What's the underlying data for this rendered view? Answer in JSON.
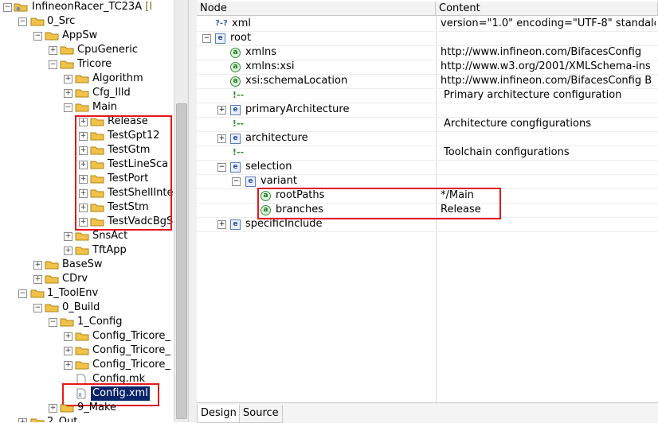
{
  "tree": {
    "items": [
      {
        "label": "InfineonRacer_TC23A",
        "suffix": "[I"
      },
      {
        "label": "0_Src"
      },
      {
        "label": "AppSw"
      },
      {
        "label": "CpuGeneric"
      },
      {
        "label": "Tricore"
      },
      {
        "label": "Algorithm"
      },
      {
        "label": "Cfg_Illd"
      },
      {
        "label": "Main"
      },
      {
        "label": "Release"
      },
      {
        "label": "TestGpt12"
      },
      {
        "label": "TestGtm"
      },
      {
        "label": "TestLineSca"
      },
      {
        "label": "TestPort"
      },
      {
        "label": "TestShellInte"
      },
      {
        "label": "TestStm"
      },
      {
        "label": "TestVadcBgS"
      },
      {
        "label": "SnsAct"
      },
      {
        "label": "TftApp"
      },
      {
        "label": "BaseSw"
      },
      {
        "label": "CDrv"
      },
      {
        "label": "1_ToolEnv"
      },
      {
        "label": "0_Build"
      },
      {
        "label": "1_Config"
      },
      {
        "label": "Config_Tricore_"
      },
      {
        "label": "Config_Tricore_"
      },
      {
        "label": "Config_Tricore_"
      },
      {
        "label": "Config.mk"
      },
      {
        "label": "Config.xml"
      },
      {
        "label": "9_Make"
      },
      {
        "label": "2_Out"
      }
    ]
  },
  "table": {
    "headers": {
      "node": "Node",
      "content": "Content"
    },
    "rows": [
      {
        "icon": "?-?",
        "name": "xml",
        "content": "version=\"1.0\" encoding=\"UTF-8\" standalo"
      },
      {
        "icon": "e",
        "name": "root",
        "content": ""
      },
      {
        "icon": "a",
        "name": "xmlns",
        "content": "http://www.infineon.com/BifacesConfig"
      },
      {
        "icon": "a",
        "name": "xmlns:xsi",
        "content": "http://www.w3.org/2001/XMLSchema-ins"
      },
      {
        "icon": "a",
        "name": "xsi:schemaLocation",
        "content": "http://www.infineon.com/BifacesConfig B"
      },
      {
        "icon": "c",
        "name": "",
        "content": "Primary architecture configuration"
      },
      {
        "icon": "e",
        "name": "primaryArchitecture",
        "content": ""
      },
      {
        "icon": "c",
        "name": "",
        "content": "Architecture congfigurations"
      },
      {
        "icon": "e",
        "name": "architecture",
        "content": ""
      },
      {
        "icon": "c",
        "name": "",
        "content": "Toolchain configurations"
      },
      {
        "icon": "e",
        "name": "selection",
        "content": ""
      },
      {
        "icon": "e",
        "name": "variant",
        "content": ""
      },
      {
        "icon": "a",
        "name": "rootPaths",
        "content": "*/Main"
      },
      {
        "icon": "a",
        "name": "branches",
        "content": "Release"
      },
      {
        "icon": "e",
        "name": "specificInclude",
        "content": ""
      }
    ]
  },
  "icons": {
    "element": "e",
    "attribute": "a",
    "comment": "!--",
    "pi": "?-?"
  },
  "tabs": {
    "design": "Design",
    "source": "Source"
  },
  "colors": {
    "highlight_box": "#e8161b",
    "selection_bg": "#0a246a"
  }
}
